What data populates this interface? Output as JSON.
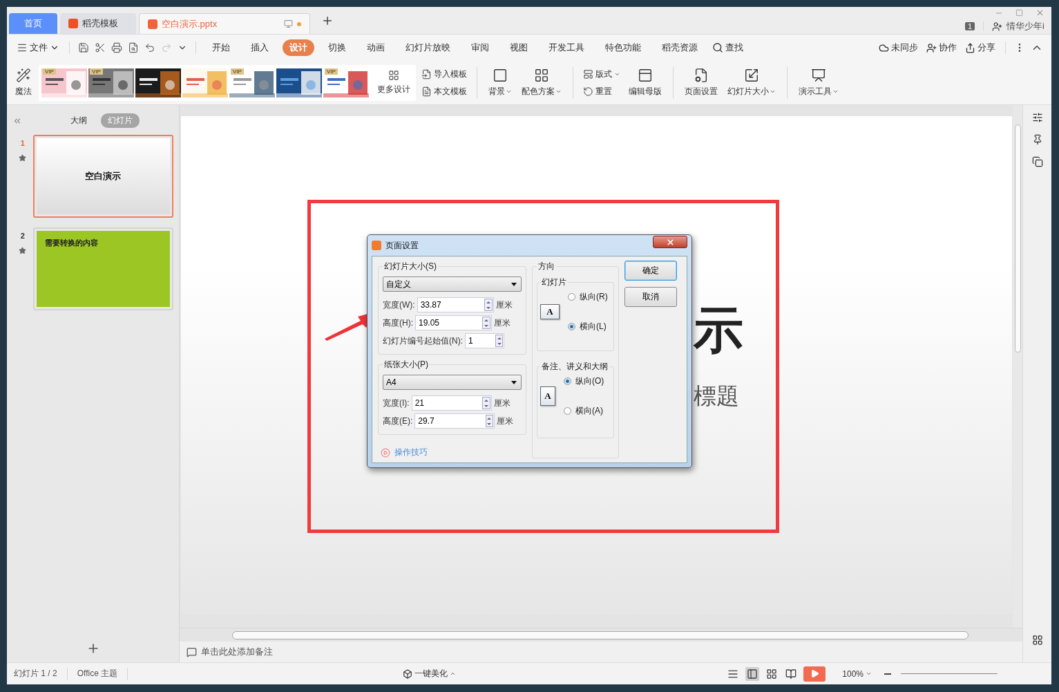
{
  "tabs": [
    {
      "label": "首页",
      "kind": "home",
      "selected": false
    },
    {
      "label": "稻壳模板",
      "kind": "docer",
      "selected": false
    },
    {
      "label": "空白演示.pptx",
      "kind": "file",
      "selected": true
    }
  ],
  "account": {
    "badge": "1",
    "user": "情华少年i"
  },
  "menu": {
    "file": "文件",
    "items": [
      {
        "label": "开始",
        "selected": false
      },
      {
        "label": "插入",
        "selected": false
      },
      {
        "label": "设计",
        "selected": true
      },
      {
        "label": "切换",
        "selected": false
      },
      {
        "label": "动画",
        "selected": false
      },
      {
        "label": "幻灯片放映",
        "selected": false
      },
      {
        "label": "审阅",
        "selected": false
      },
      {
        "label": "视图",
        "selected": false
      },
      {
        "label": "开发工具",
        "selected": false
      },
      {
        "label": "特色功能",
        "selected": false
      },
      {
        "label": "稻壳资源",
        "selected": false
      }
    ],
    "search": "查找",
    "sync": "未同步",
    "collab": "协作",
    "share": "分享"
  },
  "ribbon": {
    "magic": "魔法",
    "templates": [
      {
        "kind": "vip",
        "badge": "VIP"
      },
      {
        "kind": "vip",
        "badge": "VIP"
      },
      {
        "kind": "free"
      },
      {
        "kind": "free"
      },
      {
        "kind": "vip",
        "badge": "VIP"
      },
      {
        "kind": "free"
      },
      {
        "kind": "vip",
        "badge": "VIP"
      }
    ],
    "more": "更多设计",
    "import_template": {
      "label": "导入模板",
      "dropdown": false
    },
    "body_template": {
      "label": "本文模板",
      "dropdown": false
    },
    "background": {
      "label": "背景",
      "dropdown": true
    },
    "color_scheme": {
      "label": "配色方案",
      "dropdown": true
    },
    "layout": {
      "label": "版式",
      "dropdown": true
    },
    "reset": {
      "label": "重置",
      "dropdown": false
    },
    "edit_master": {
      "label": "编辑母版",
      "dropdown": false
    },
    "page_setup": {
      "label": "页面设置",
      "dropdown": false
    },
    "slide_size": {
      "label": "幻灯片大小",
      "dropdown": true
    },
    "presenter_tools": {
      "label": "演示工具",
      "dropdown": true
    }
  },
  "panel": {
    "tabs": [
      {
        "label": "大纲",
        "selected": false
      },
      {
        "label": "幻灯片",
        "selected": true
      }
    ],
    "slides": [
      {
        "number": "1",
        "selected": true,
        "title": "空白演示",
        "color": "#ffffff"
      },
      {
        "number": "2",
        "selected": false,
        "text": "需要转换的内容",
        "color": "#9bc623"
      }
    ]
  },
  "slide": {
    "title": "示",
    "subtitle": "標題"
  },
  "dialog": {
    "title": "页面设置",
    "slide_size": {
      "label": "幻灯片大小(S)",
      "select": "自定义",
      "fields": [
        {
          "label": "宽度(W):",
          "value": "33.87",
          "unit": "厘米"
        },
        {
          "label": "高度(H):",
          "value": "19.05",
          "unit": "厘米"
        }
      ],
      "start": {
        "label": "幻灯片编号起始值(N):",
        "value": "1"
      }
    },
    "paper_size": {
      "label": "纸张大小(P)",
      "select": "A4",
      "fields": [
        {
          "label": "宽度(I):",
          "value": "21",
          "unit": "厘米"
        },
        {
          "label": "高度(E):",
          "value": "29.7",
          "unit": "厘米"
        }
      ]
    },
    "orientation": {
      "label": "方向",
      "groups": [
        {
          "label": "幻灯片",
          "preview": "A",
          "kind": "landscape",
          "options": [
            {
              "label": "纵向(R)",
              "selected": false
            },
            {
              "label": "横向(L)",
              "selected": true
            }
          ]
        },
        {
          "label": "备注、讲义和大纲",
          "preview": "A",
          "kind": "portrait",
          "options": [
            {
              "label": "纵向(O)",
              "selected": true
            },
            {
              "label": "横向(A)",
              "selected": false
            }
          ]
        }
      ]
    },
    "ok": "确定",
    "cancel": "取消",
    "tips": "操作技巧"
  },
  "notes": "单击此处添加备注",
  "status": {
    "slide": "幻灯片 1 / 2",
    "theme": "Office 主题",
    "beautify": "一键美化",
    "zoom": "100%"
  }
}
